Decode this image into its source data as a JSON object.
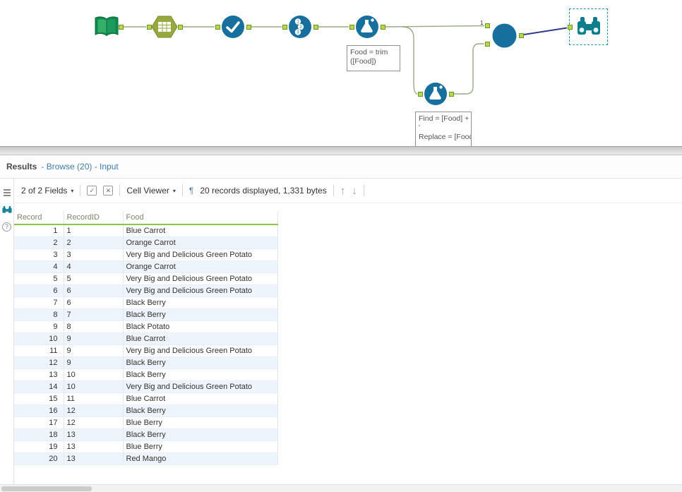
{
  "colors": {
    "tool_blue": "#176f9e",
    "anchor_green": "#b5d94e",
    "accent_green": "#8cc63f",
    "browse_teal": "#0d7f8c",
    "selected_wire_blue": "#2e3b8f",
    "alt_row_blue": "#eef4fb"
  },
  "canvas": {
    "connection_label": "1",
    "annotation_formula1": "Food = trim ([Food])",
    "annotation_formula2": {
      "line1": "Find = [Food] + '",
      "line2": "'",
      "line3": "Replace = [Food]"
    }
  },
  "results": {
    "title": "Results",
    "subtitle": "- Browse (20) - Input",
    "toolbar": {
      "fields_dropdown": "2 of 2 Fields",
      "caret": "▾",
      "apply_glyph": "✓",
      "cancel_glyph": "✕",
      "cell_viewer_dropdown": "Cell Viewer",
      "pilcrow": "¶",
      "records_info": "20 records displayed, 1,331 bytes",
      "up_arrow": "↑",
      "down_arrow": "↓"
    },
    "sidebar": {
      "help_glyph": "?"
    },
    "table": {
      "columns": [
        "Record",
        "RecordID",
        "Food"
      ],
      "rows": [
        [
          1,
          "1",
          "Blue Carrot"
        ],
        [
          2,
          "2",
          "Orange Carrot"
        ],
        [
          3,
          "3",
          "Very Big and Delicious Green Potato"
        ],
        [
          4,
          "4",
          "Orange Carrot"
        ],
        [
          5,
          "5",
          "Very Big and Delicious Green Potato"
        ],
        [
          6,
          "6",
          "Very Big and Delicious Green Potato"
        ],
        [
          7,
          "6",
          "Black Berry"
        ],
        [
          8,
          "7",
          "Black Berry"
        ],
        [
          9,
          "8",
          "Black Potato"
        ],
        [
          10,
          "9",
          "Blue Carrot"
        ],
        [
          11,
          "9",
          "Very Big and Delicious Green Potato"
        ],
        [
          12,
          "9",
          "Black Berry"
        ],
        [
          13,
          "10",
          "Black Berry"
        ],
        [
          14,
          "10",
          "Very Big and Delicious Green Potato"
        ],
        [
          15,
          "11",
          "Blue Carrot"
        ],
        [
          16,
          "12",
          "Black Berry"
        ],
        [
          17,
          "12",
          "Blue Berry"
        ],
        [
          18,
          "13",
          "Black Berry"
        ],
        [
          19,
          "13",
          "Blue Berry"
        ],
        [
          20,
          "13",
          "Red Mango"
        ]
      ]
    }
  }
}
